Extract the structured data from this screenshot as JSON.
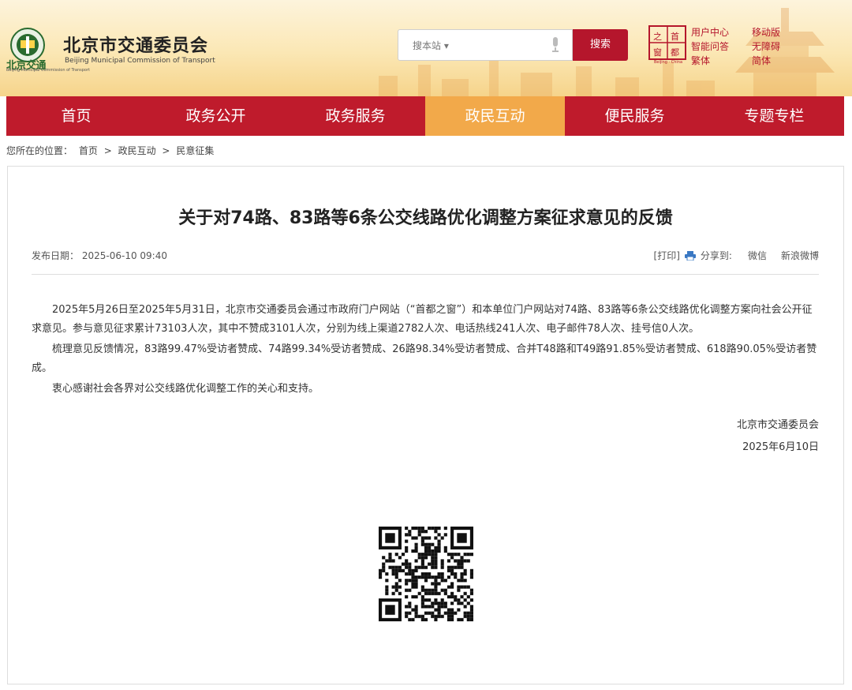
{
  "site": {
    "logo_small": "北京交通",
    "logo_tiny": "Beijing Municipal Commission of Transport",
    "title": "北京市交通委员会",
    "title_en": "Beijing Municipal Commission of Transport"
  },
  "search": {
    "placeholder": "搜本站 ▾",
    "button": "搜索"
  },
  "window_logo": {
    "tag": "Beijing · China"
  },
  "header_links": [
    "用户中心",
    "移动版",
    "智能问答",
    "无障碍",
    "繁体",
    "简体"
  ],
  "nav": {
    "items": [
      {
        "label": "首页"
      },
      {
        "label": "政务公开"
      },
      {
        "label": "政务服务"
      },
      {
        "label": "政民互动",
        "active": true
      },
      {
        "label": "便民服务"
      },
      {
        "label": "专题专栏"
      }
    ]
  },
  "breadcrumb": {
    "prefix": "您所在的位置：",
    "items": [
      "首页",
      "政民互动",
      "民意征集"
    ],
    "separator": ">"
  },
  "article": {
    "title": "关于对74路、83路等6条公交线路优化调整方案征求意见的反馈",
    "date_label": "发布日期：",
    "date": "2025-06-10 09:40",
    "print": "[打印]",
    "share_label": "分享到:",
    "share_wechat": "微信",
    "share_weibo": "新浪微博",
    "paragraphs": [
      "2025年5月26日至2025年5月31日，北京市交通委员会通过市政府门户网站（“首都之窗”）和本单位门户网站对74路、83路等6条公交线路优化调整方案向社会公开征求意见。参与意见征求累计73103人次，其中不赞成3101人次，分别为线上渠道2782人次、电话热线241人次、电子邮件78人次、挂号信0人次。",
      "梳理意见反馈情况，83路99.47%受访者赞成、74路99.34%受访者赞成、26路98.34%受访者赞成、合并T48路和T49路91.85%受访者赞成、618路90.05%受访者赞成。",
      "衷心感谢社会各界对公交线路优化调整工作的关心和支持。"
    ],
    "signature": "北京市交通委员会",
    "sign_date": "2025年6月10日"
  },
  "colors": {
    "brand_red": "#bf1b2c",
    "active_tab": "#f2a94a"
  }
}
